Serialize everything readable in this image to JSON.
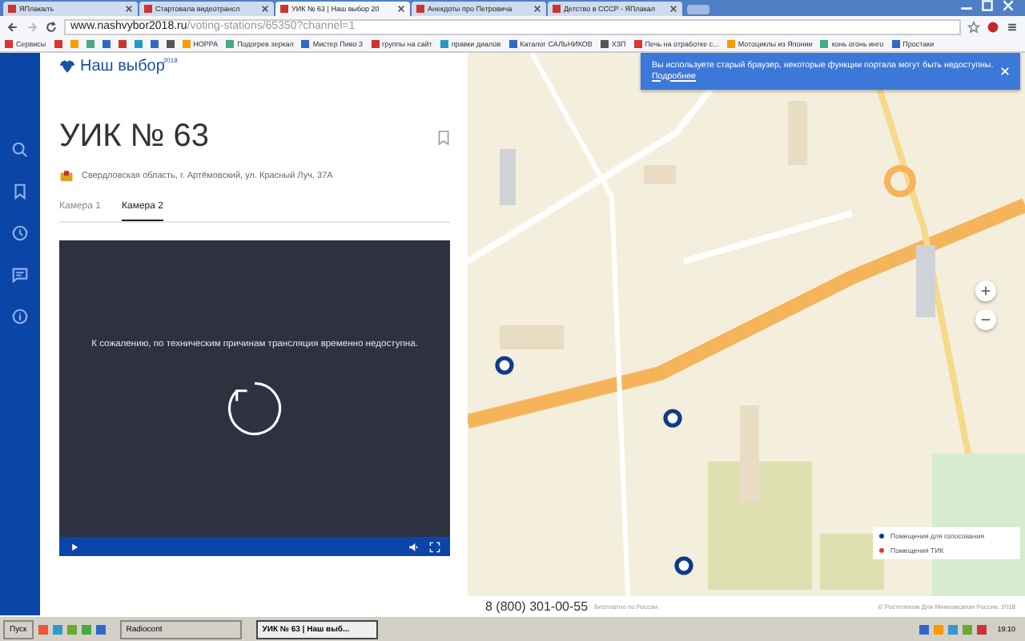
{
  "browser": {
    "tabs": [
      {
        "title": "ЯПлакалъ",
        "selected": false
      },
      {
        "title": "Стартовала видеотрансл",
        "selected": false
      },
      {
        "title": "УИК № 63 | Наш выбор 20",
        "selected": true
      },
      {
        "title": "Анекдоты про Петровича",
        "selected": false
      },
      {
        "title": "Детство в СССР - ЯПлакал",
        "selected": false
      }
    ],
    "address_host": "www.nashvybor2018.ru",
    "address_path": "/voting-stations/65350?channel=1",
    "bookmarks": [
      "Сервисы",
      "НОРРА",
      "Подогрев зеркал",
      "Мистер Пиво 3",
      "группы на сайт",
      "правки диалов",
      "Каталог САЛЬНИКОВ",
      "ХЗП",
      "Печь на отработке с...",
      "Мотоциклы из Японии",
      "конь огонь инго",
      "Простаки"
    ]
  },
  "logo": {
    "name": "Наш выбор",
    "year": "2018"
  },
  "station": {
    "title": "УИК № 63",
    "address": "Свердловская область, г. Артёмовский, ул. Красный Луч, 37А"
  },
  "camera_tabs": [
    {
      "label": "Камера 1",
      "selected": false
    },
    {
      "label": "Камера 2",
      "selected": true
    }
  ],
  "player": {
    "message": "К сожалению, по техническим причинам трансляция временно недоступна."
  },
  "notice": {
    "text": "Вы используете старый браузер, некоторые функции портала могут быть недоступны.",
    "link": "Подробнее"
  },
  "legend": [
    {
      "label": "Помещения для голосования",
      "color": "#0d3a8c"
    },
    {
      "label": "Помещения ТИК",
      "color": "#e53935"
    }
  ],
  "footer": {
    "phone": "8 (800) 301-00-55",
    "phone_note": "Бесплатно по России",
    "copyright": "© Ростелеком Для Минкомсвязи России, 2018"
  },
  "taskbar": {
    "start": "Пуск",
    "windows": [
      {
        "title": "Radiocont",
        "selected": false
      },
      {
        "title": "УИК № 63 | Наш выб...",
        "selected": true
      }
    ],
    "clock": "19:10"
  }
}
